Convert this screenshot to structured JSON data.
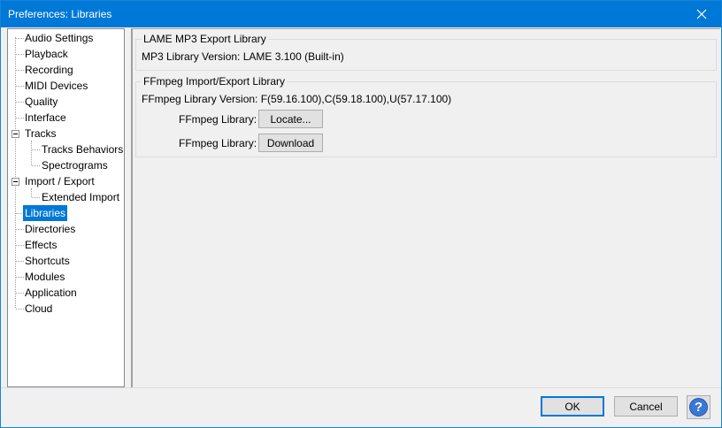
{
  "window": {
    "title": "Preferences: Libraries"
  },
  "tree": {
    "items": [
      {
        "label": "Audio Settings"
      },
      {
        "label": "Playback"
      },
      {
        "label": "Recording"
      },
      {
        "label": "MIDI Devices"
      },
      {
        "label": "Quality"
      },
      {
        "label": "Interface"
      },
      {
        "label": "Tracks"
      },
      {
        "label": "Tracks Behaviors"
      },
      {
        "label": "Spectrograms"
      },
      {
        "label": "Import / Export"
      },
      {
        "label": "Extended Import"
      },
      {
        "label": "Libraries"
      },
      {
        "label": "Directories"
      },
      {
        "label": "Effects"
      },
      {
        "label": "Shortcuts"
      },
      {
        "label": "Modules"
      },
      {
        "label": "Application"
      },
      {
        "label": "Cloud"
      }
    ],
    "selected": "Libraries"
  },
  "lame": {
    "group_title": "LAME MP3 Export Library",
    "version_text": "MP3 Library Version: LAME 3.100 (Built-in)"
  },
  "ffmpeg": {
    "group_title": "FFmpeg Import/Export Library",
    "version_text": "FFmpeg Library Version: F(59.16.100),C(59.18.100),U(57.17.100)",
    "locate_label": "FFmpeg Library:",
    "locate_button": "Locate...",
    "download_label": "FFmpeg Library:",
    "download_button": "Download"
  },
  "footer": {
    "ok_label": "OK",
    "cancel_label": "Cancel",
    "help_glyph": "?"
  },
  "colors": {
    "title_bar": "#0078d7",
    "selection": "#0078d7"
  }
}
